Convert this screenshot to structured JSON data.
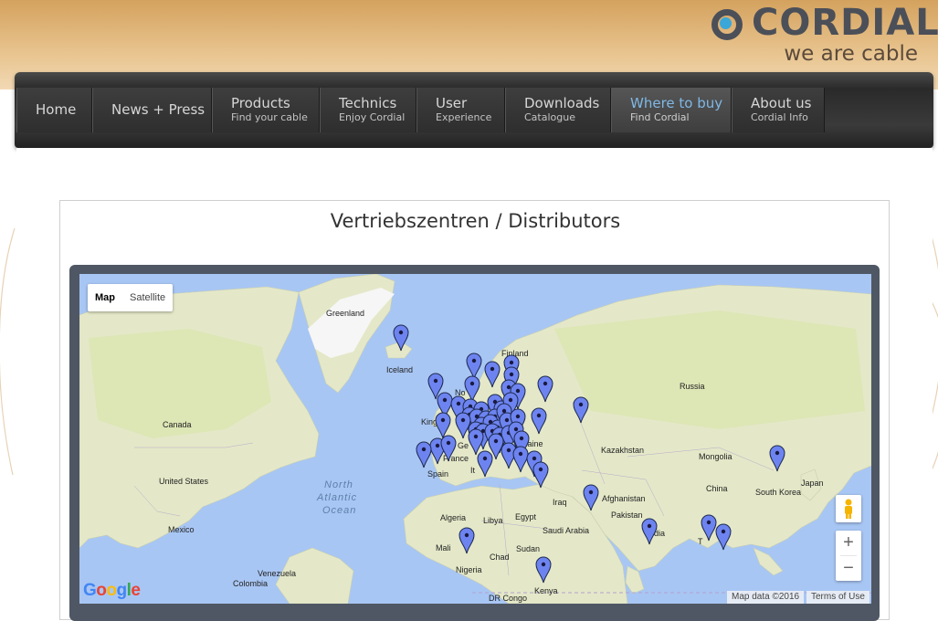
{
  "brand": {
    "name": "CORDIAL",
    "tagline": "we are cable"
  },
  "nav": [
    {
      "title": "Home",
      "sub": ""
    },
    {
      "title": "News + Press",
      "sub": ""
    },
    {
      "title": "Products",
      "sub": "Find your cable"
    },
    {
      "title": "Technics",
      "sub": "Enjoy Cordial"
    },
    {
      "title": "User",
      "sub": "Experience"
    },
    {
      "title": "Downloads",
      "sub": "Catalogue"
    },
    {
      "title": "Where to buy",
      "sub": "Find Cordial"
    },
    {
      "title": "About us",
      "sub": "Cordial Info"
    }
  ],
  "active_nav": "Where to buy",
  "page_title": "Vertriebszentren / Distributors",
  "map": {
    "type_buttons": [
      "Map",
      "Satellite"
    ],
    "selected_type": "Map",
    "zoom_in": "+",
    "zoom_out": "−",
    "google": "Google",
    "attribution": "Map data ©2016",
    "terms": "Terms of Use",
    "labels": {
      "greenland": "Greenland",
      "iceland": "Iceland",
      "finland": "Finland",
      "russia": "Russia",
      "canada": "Canada",
      "united_states": "United States",
      "mexico": "Mexico",
      "kazakhstan": "Kazakhstan",
      "mongolia": "Mongolia",
      "china": "China",
      "japan": "Japan",
      "south_korea": "South Korea",
      "afghanistan": "Afghanistan",
      "pakistan": "Pakistan",
      "iraq": "Iraq",
      "saudi_arabia": "Saudi Arabia",
      "egypt": "Egypt",
      "libya": "Libya",
      "algeria": "Algeria",
      "mali": "Mali",
      "chad": "Chad",
      "sudan": "Sudan",
      "nigeria": "Nigeria",
      "kenya": "Kenya",
      "dr_congo": "DR Congo",
      "venezuela": "Venezuela",
      "colombia": "Colombia",
      "spain": "Spain",
      "france": "France",
      "india": "India",
      "ocean_1": "North",
      "ocean_2": "Atlantic",
      "ocean_3": "Ocean",
      "partial_norway": "No",
      "partial_kingdom": "King",
      "partial_germany": "Ge",
      "partial_ukraine": "kraine",
      "partial_italy": "It",
      "partial_india": "dia",
      "partial_thailand": "T"
    }
  },
  "colors": {
    "accent_link": "#7fb8e6",
    "marker": "#6d84f0",
    "land": "#e5e8c9",
    "water": "#a8c6f4"
  }
}
